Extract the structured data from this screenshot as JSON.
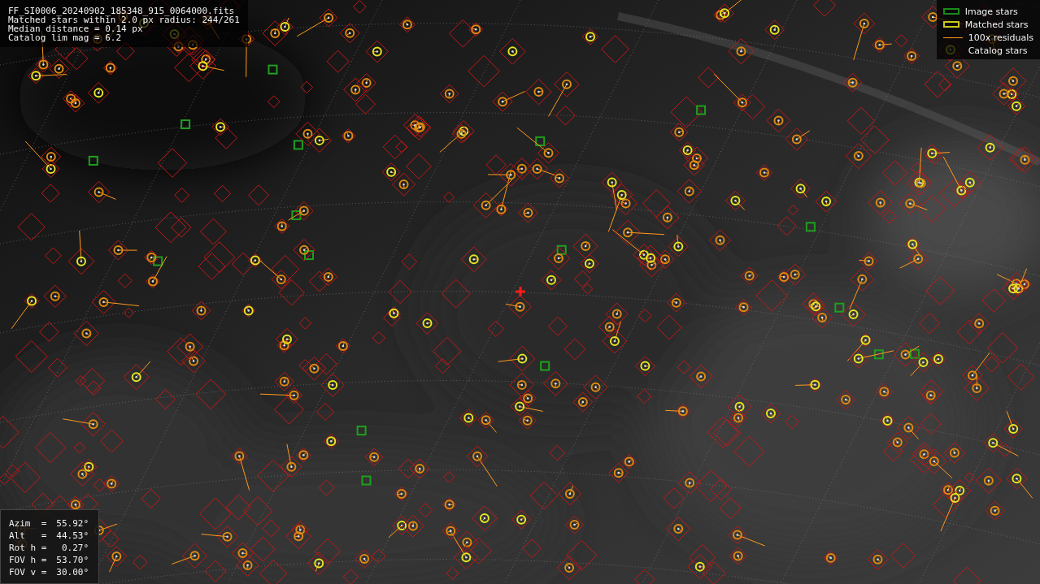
{
  "header": {
    "lines": [
      "FF_SI0006_20240902_185348_915_0064000.fits",
      "Matched stars within 2.0 px radius: 244/261",
      "Median distance = 0.14 px",
      "Catalog lim mag = 6.2"
    ]
  },
  "legend": [
    {
      "kind": "box",
      "color": "#1a8a1a",
      "label": "Image stars"
    },
    {
      "kind": "box",
      "color": "#c8c81e",
      "label": "Matched stars"
    },
    {
      "kind": "line",
      "color": "#ff9a1a",
      "label": "100x residuals"
    },
    {
      "kind": "none",
      "label": "Catalog stars"
    }
  ],
  "pointing": [
    {
      "label": "Azim  =",
      "value": "55.92°"
    },
    {
      "label": "Alt   =",
      "value": "44.53°"
    },
    {
      "label": "Rot h =",
      "value": " 0.27°"
    },
    {
      "label": "FOV h =",
      "value": "53.70°"
    },
    {
      "label": "FOV v =",
      "value": "30.00°"
    }
  ]
}
